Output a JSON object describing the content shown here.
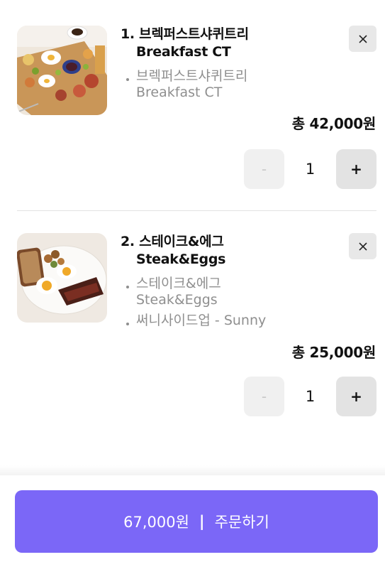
{
  "cart": {
    "items": [
      {
        "name_ko": "1. 브렉퍼스트샤퀴트리",
        "name_en": "Breakfast CT",
        "options": [
          "브렉퍼스트샤퀴트리",
          "Breakfast CT"
        ],
        "total": "총 42,000원",
        "quantity": "1",
        "minus_label": "-",
        "plus_label": "+",
        "image": "breakfast-platter-photo"
      },
      {
        "name_ko": "2. 스테이크&에그",
        "name_en": "Steak&Eggs",
        "options": [
          "스테이크&에그",
          "Steak&Eggs",
          "써니사이드업 - Sunny"
        ],
        "total": "총 25,000원",
        "quantity": "1",
        "minus_label": "-",
        "plus_label": "+",
        "image": "steak-and-eggs-photo"
      }
    ]
  },
  "order": {
    "amount": "67,000원",
    "separator": "|",
    "label": "주문하기"
  },
  "colors": {
    "accent": "#7b67f7",
    "muted_text": "#8f8f8f",
    "button_bg": "#e3e3e3"
  },
  "icons": {
    "close": "close-icon"
  }
}
